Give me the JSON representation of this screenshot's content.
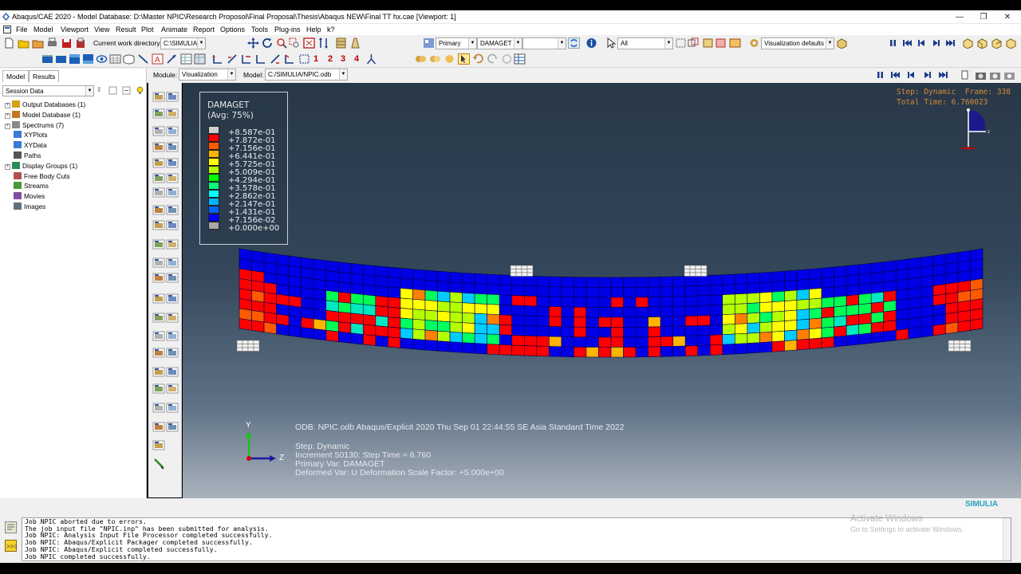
{
  "window": {
    "title": "Abaqus/CAE 2020 - Model Database: D:\\Master NPIC\\Research Proposol\\Final Proposal\\Thesis\\Abaqus NEW\\Final TT hx.cae [Viewport: 1]",
    "minimize": "—",
    "maximize": "❐",
    "close": "✕"
  },
  "menu": [
    "File",
    "Model",
    "Viewport",
    "View",
    "Result",
    "Plot",
    "Animate",
    "Report",
    "Options",
    "Tools",
    "Plug-ins",
    "Help",
    "k?"
  ],
  "toolbar": {
    "cwd_label": "Current work directory:",
    "cwd_value": "C:\\SIMULIA",
    "primary": "Primary",
    "variable": "DAMAGET",
    "blank": "",
    "all": "All",
    "vis_defaults": "Visualization defaults",
    "node_labels": [
      "1",
      "2",
      "3",
      "4"
    ]
  },
  "context": {
    "module_label": "Module:",
    "module_value": "Visualization",
    "model_label": "Model:",
    "model_value": "C:/SIMULIA/NPIC.odb"
  },
  "tabs": [
    "Model",
    "Results"
  ],
  "session": "Session Data",
  "tree": [
    {
      "label": "Output Databases (1)",
      "exp": true,
      "color": "#d4a017"
    },
    {
      "label": "Model Database (1)",
      "exp": true,
      "color": "#c07a1a"
    },
    {
      "label": "Spectrums (7)",
      "exp": true,
      "color": "#8a8a8a"
    },
    {
      "label": "XYPlots",
      "exp": false,
      "color": "#3a7bd5"
    },
    {
      "label": "XYData",
      "exp": false,
      "color": "#3a7bd5"
    },
    {
      "label": "Paths",
      "exp": false,
      "color": "#555"
    },
    {
      "label": "Display Groups (1)",
      "exp": true,
      "color": "#2e8b57"
    },
    {
      "label": "Free Body Cuts",
      "exp": false,
      "color": "#b05050"
    },
    {
      "label": "Streams",
      "exp": false,
      "color": "#4a9a3a"
    },
    {
      "label": "Movies",
      "exp": false,
      "color": "#8050a0"
    },
    {
      "label": "Images",
      "exp": false,
      "color": "#607080"
    }
  ],
  "legend": {
    "title": "DAMAGET",
    "avg": "(Avg: 75%)",
    "values": [
      "+8.587e-01",
      "+7.872e-01",
      "+7.156e-01",
      "+6.441e-01",
      "+5.725e-01",
      "+5.009e-01",
      "+4.294e-01",
      "+3.578e-01",
      "+2.862e-01",
      "+2.147e-01",
      "+1.431e-01",
      "+7.156e-02",
      "+0.000e+00"
    ],
    "colors": [
      "#cfcfcf",
      "#ff0000",
      "#ff5a00",
      "#ffb400",
      "#ffff00",
      "#b4ff00",
      "#00ff00",
      "#00ff78",
      "#00ffff",
      "#00b4ff",
      "#0064ff",
      "#0000ff",
      "#a8a8a8"
    ]
  },
  "stepinfo": {
    "line1": "Step: Dynamic  Frame: 338",
    "line2": "Total Time: 6.760023"
  },
  "triad": {
    "y": "Y",
    "z": "Z"
  },
  "odb": {
    "line1": "ODB: NPIC.odb    Abaqus/Explicit 2020    Thu Sep 01 22:44:55 SE Asia Standard Time 2022",
    "line2": "Step: Dynamic",
    "line3": "Increment     50130: Step Time =     6.760",
    "line4": "Primary Var: DAMAGET",
    "line5": "Deformed Var: U   Deformation Scale Factor: +5.000e+00"
  },
  "messages": [
    "Job NPIC aborted due to errors.",
    "The job input file \"NPIC.inp\" has been submitted for analysis.",
    "Job NPIC: Analysis Input File Processor completed successfully.",
    "Job NPIC: Abaqus/Explicit Packager completed successfully.",
    "Job NPIC: Abaqus/Explicit completed successfully.",
    "Job NPIC completed successfully."
  ],
  "activate": {
    "title": "Activate Windows",
    "sub": "Go to Settings to activate Windows."
  },
  "brand": "SIMULIA"
}
